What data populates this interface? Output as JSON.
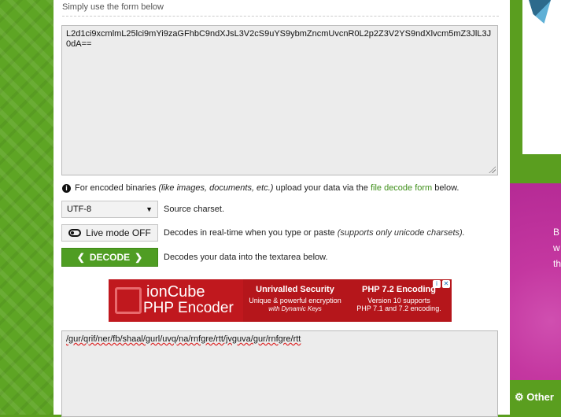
{
  "form": {
    "hint": "Simply use the form below",
    "input_text": "L2d1ci9xcmlmL25lci9mYi9zaGFhbC9ndXJsL3V2cS9uYS9ybmZncmUvcnR0L2p2Z3V2YS9ndXlvcm5mZ3JlL3J0dA==",
    "info_prefix": "For encoded binaries",
    "info_italic": "(like images, documents, etc.)",
    "info_middle": "upload your data via the",
    "info_link": "file decode form",
    "info_suffix": "below.",
    "charset_value": "UTF-8",
    "charset_label": "Source charset.",
    "live_mode_label": "Live mode OFF",
    "live_mode_desc": "Decodes in real-time when you type or paste",
    "live_mode_note": "(supports only unicode charsets).",
    "decode_label": "DECODE",
    "decode_desc": "Decodes your data into the textarea below.",
    "output_text": "/gur/qrif/ner/fb/shaal/gurl/uvq/na/rnfgre/rtt/jvguva/gur/rnfgre/rtt"
  },
  "ad": {
    "brand_line1": "ionCube",
    "brand_line2": "PHP Encoder",
    "col1_title": "Unrivalled Security",
    "col1_line1": "Unique & powerful encryption",
    "col1_line2": "with Dynamic Keys",
    "col2_title": "PHP 7.2 Encoding",
    "col2_line1": "Version 10 supports",
    "col2_line2": "PHP 7.1 and 7.2 encoding."
  },
  "sidebar": {
    "ad_text_lines": [
      "B",
      "w",
      "th"
    ],
    "other_label": "Other"
  },
  "colors": {
    "brand_green": "#4f9d23",
    "ad_red": "#b5161b",
    "sidebar_magenta": "#c437a0"
  }
}
